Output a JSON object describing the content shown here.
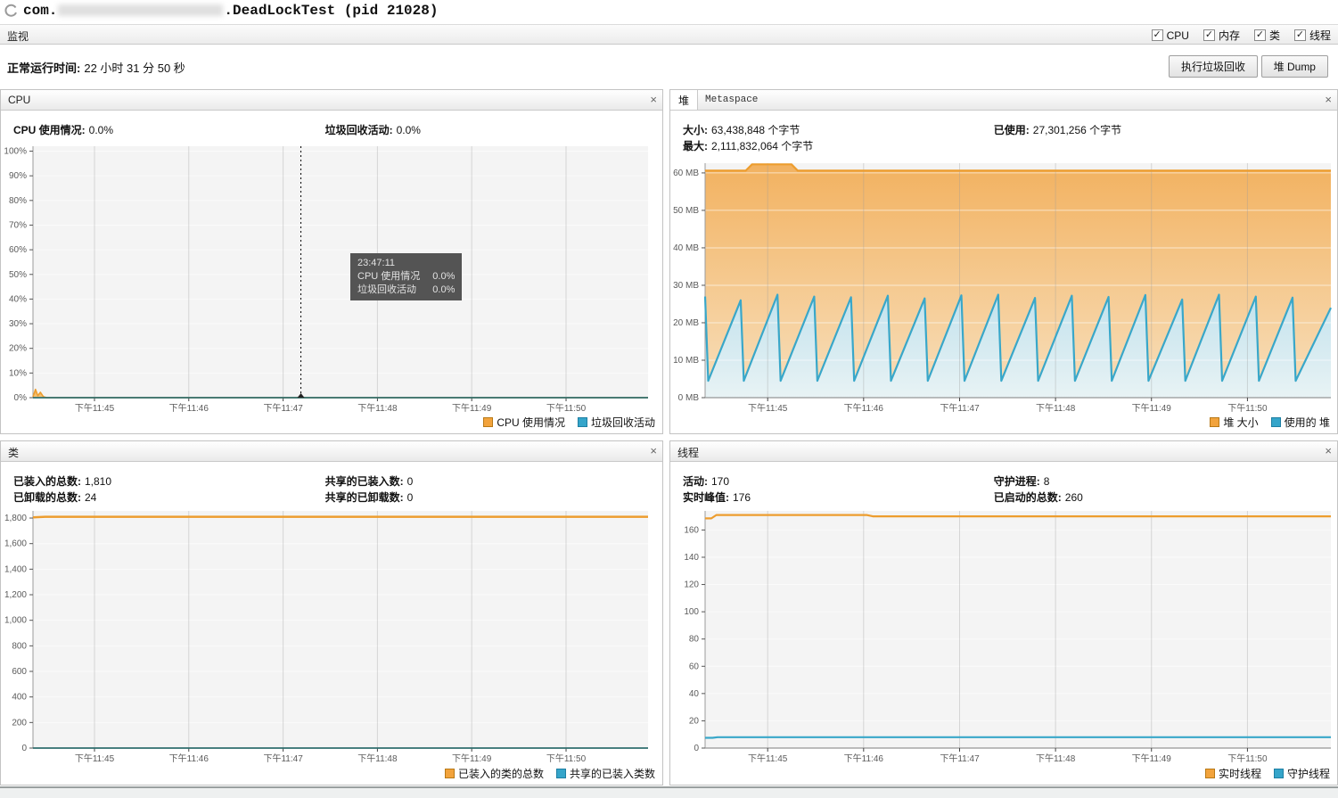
{
  "window": {
    "title": {
      "prefix": "com.",
      "suffix": ".DeadLockTest (pid 21028)"
    },
    "tabbar": {
      "tab": "监视",
      "checkboxes": [
        {
          "label": "CPU",
          "checked": true
        },
        {
          "label": "内存",
          "checked": true
        },
        {
          "label": "类",
          "checked": true
        },
        {
          "label": "线程",
          "checked": true
        }
      ],
      "check_glyph": "✓"
    },
    "toolbar": {
      "uptime_label": "正常运行时间:",
      "uptime_value": "22 小时 31 分 50 秒",
      "gc_button": "执行垃圾回收",
      "heap_dump_button": "堆 Dump"
    }
  },
  "panels": {
    "cpu": {
      "title": "CPU",
      "close": "×",
      "stats": [
        {
          "label": "CPU 使用情况:",
          "value": "0.0%"
        },
        {
          "label": "垃圾回收活动:",
          "value": "0.0%"
        }
      ]
    },
    "heap": {
      "tabs": [
        "堆",
        "Metaspace"
      ],
      "close": "×",
      "stats": [
        {
          "label": "大小:",
          "value": "63,438,848 个字节"
        },
        {
          "label": "已使用:",
          "value": "27,301,256 个字节"
        },
        {
          "label": "最大:",
          "value": "2,111,832,064 个字节"
        }
      ]
    },
    "classes": {
      "title": "类",
      "close": "×",
      "stats": [
        {
          "label": "已装入的总数:",
          "value": "1,810"
        },
        {
          "label": "共享的已装入数:",
          "value": "0"
        },
        {
          "label": "已卸载的总数:",
          "value": "24"
        },
        {
          "label": "共享的已卸载数:",
          "value": "0"
        }
      ]
    },
    "threads": {
      "title": "线程",
      "close": "×",
      "stats": [
        {
          "label": "活动:",
          "value": "170"
        },
        {
          "label": "守护进程:",
          "value": "8"
        },
        {
          "label": "实时峰值:",
          "value": "176"
        },
        {
          "label": "已启动的总数:",
          "value": "260"
        }
      ]
    }
  },
  "chart_data": [
    {
      "id": "cpu",
      "type": "area",
      "title": "CPU",
      "ylim": [
        0,
        102
      ],
      "yticks": [
        {
          "v": 0,
          "label": "0%"
        },
        {
          "v": 10,
          "label": "10%"
        },
        {
          "v": 20,
          "label": "20%"
        },
        {
          "v": 30,
          "label": "30%"
        },
        {
          "v": 40,
          "label": "40%"
        },
        {
          "v": 50,
          "label": "50%"
        },
        {
          "v": 60,
          "label": "60%"
        },
        {
          "v": 70,
          "label": "70%"
        },
        {
          "v": 80,
          "label": "80%"
        },
        {
          "v": 90,
          "label": "90%"
        },
        {
          "v": 100,
          "label": "100%"
        }
      ],
      "xticks": [
        {
          "f": 0.1,
          "label": "下午11:45"
        },
        {
          "f": 0.2533,
          "label": "下午11:46"
        },
        {
          "f": 0.4067,
          "label": "下午11:47"
        },
        {
          "f": 0.56,
          "label": "下午11:48"
        },
        {
          "f": 0.7133,
          "label": "下午11:49"
        },
        {
          "f": 0.8667,
          "label": "下午11:50"
        }
      ],
      "series": [
        {
          "name": "CPU 使用情况",
          "color": "#ed9d2e",
          "width": 1.5,
          "fill": {
            "from": "#f0a030",
            "to": "#f5c478"
          },
          "points": [
            [
              0,
              0.3
            ],
            [
              0.004,
              3.4
            ],
            [
              0.008,
              0.8
            ],
            [
              0.012,
              2.2
            ],
            [
              0.017,
              0.4
            ],
            [
              0.022,
              0
            ],
            [
              1,
              0
            ]
          ]
        },
        {
          "name": "垃圾回收活动",
          "color": "#2f6e6e",
          "width": 1.8,
          "points": [
            [
              0,
              0
            ],
            [
              1,
              0
            ]
          ]
        }
      ],
      "legend": [
        {
          "color": "#f2a33c",
          "border": "#b87916",
          "label": "CPU 使用情况"
        },
        {
          "color": "#35a5ca",
          "border": "#1e7fa3",
          "label": "垃圾回收活动"
        }
      ],
      "crosshair_f": 0.4356,
      "tooltip": {
        "time": "23:47:11",
        "rows": [
          {
            "label": "CPU 使用情况",
            "value": "0.0%"
          },
          {
            "label": "垃圾回收活动",
            "value": "0.0%"
          }
        ]
      }
    },
    {
      "id": "heap",
      "type": "area",
      "title": "堆",
      "ylim": [
        0,
        62.6
      ],
      "yticks": [
        {
          "v": 0,
          "label": "0 MB"
        },
        {
          "v": 10,
          "label": "10 MB"
        },
        {
          "v": 20,
          "label": "20 MB"
        },
        {
          "v": 30,
          "label": "30 MB"
        },
        {
          "v": 40,
          "label": "40 MB"
        },
        {
          "v": 50,
          "label": "50 MB"
        },
        {
          "v": 60,
          "label": "60 MB"
        }
      ],
      "xticks": [
        {
          "f": 0.1,
          "label": "下午11:45"
        },
        {
          "f": 0.2533,
          "label": "下午11:46"
        },
        {
          "f": 0.4067,
          "label": "下午11:47"
        },
        {
          "f": 0.56,
          "label": "下午11:48"
        },
        {
          "f": 0.7133,
          "label": "下午11:49"
        },
        {
          "f": 0.8667,
          "label": "下午11:50"
        }
      ],
      "series": [
        {
          "name": "堆 大小",
          "color": "#ed9d2e",
          "width": 2.2,
          "fill": {
            "from": "#f2ae58",
            "to": "#f8ddb6"
          },
          "points": [
            [
              0,
              60.6
            ],
            [
              0.065,
              60.6
            ],
            [
              0.075,
              62.3
            ],
            [
              0.138,
              62.3
            ],
            [
              0.148,
              60.6
            ],
            [
              1,
              60.6
            ]
          ]
        },
        {
          "name": "使用的 堆",
          "color": "#39a7c9",
          "width": 2.2,
          "fill": {
            "from": "#bfe3f2",
            "to": "#e6f5fb"
          },
          "points": [
            [
              0,
              27
            ],
            [
              0.005,
              4.5
            ],
            [
              0.0568,
              26
            ],
            [
              0.0618,
              4.5
            ],
            [
              0.1156,
              27.5
            ],
            [
              0.1206,
              4.5
            ],
            [
              0.1744,
              27
            ],
            [
              0.1794,
              4.5
            ],
            [
              0.2332,
              26.8
            ],
            [
              0.2382,
              4.5
            ],
            [
              0.292,
              27.2
            ],
            [
              0.297,
              4.5
            ],
            [
              0.3508,
              26.5
            ],
            [
              0.3558,
              4.5
            ],
            [
              0.4096,
              27.3
            ],
            [
              0.4146,
              4.5
            ],
            [
              0.4684,
              27.5
            ],
            [
              0.4734,
              4.5
            ],
            [
              0.5272,
              26.6
            ],
            [
              0.5322,
              4.5
            ],
            [
              0.586,
              27.2
            ],
            [
              0.591,
              4.5
            ],
            [
              0.6448,
              26.9
            ],
            [
              0.6498,
              4.5
            ],
            [
              0.7036,
              27.4
            ],
            [
              0.7086,
              4.5
            ],
            [
              0.7624,
              26.2
            ],
            [
              0.7674,
              4.5
            ],
            [
              0.8212,
              27.5
            ],
            [
              0.8262,
              4.5
            ],
            [
              0.88,
              27
            ],
            [
              0.885,
              4.5
            ],
            [
              0.9388,
              26.7
            ],
            [
              0.9438,
              4.5
            ],
            [
              1,
              24
            ]
          ]
        }
      ],
      "legend": [
        {
          "color": "#f2a33c",
          "border": "#b87916",
          "label": "堆 大小"
        },
        {
          "color": "#35a5ca",
          "border": "#1e7fa3",
          "label": "使用的 堆"
        }
      ]
    },
    {
      "id": "classes",
      "type": "line",
      "title": "类",
      "ylim": [
        0,
        1856
      ],
      "yticks": [
        {
          "v": 0,
          "label": "0"
        },
        {
          "v": 200,
          "label": "200"
        },
        {
          "v": 400,
          "label": "400"
        },
        {
          "v": 600,
          "label": "600"
        },
        {
          "v": 800,
          "label": "800"
        },
        {
          "v": 1000,
          "label": "1,000"
        },
        {
          "v": 1200,
          "label": "1,200"
        },
        {
          "v": 1400,
          "label": "1,400"
        },
        {
          "v": 1600,
          "label": "1,600"
        },
        {
          "v": 1800,
          "label": "1,800"
        }
      ],
      "xticks": [
        {
          "f": 0.1,
          "label": "下午11:45"
        },
        {
          "f": 0.2533,
          "label": "下午11:46"
        },
        {
          "f": 0.4067,
          "label": "下午11:47"
        },
        {
          "f": 0.56,
          "label": "下午11:48"
        },
        {
          "f": 0.7133,
          "label": "下午11:49"
        },
        {
          "f": 0.8667,
          "label": "下午11:50"
        }
      ],
      "series": [
        {
          "name": "已装入的类的总数",
          "color": "#ed9d2e",
          "width": 2.5,
          "points": [
            [
              0,
              1806
            ],
            [
              0.02,
              1810
            ],
            [
              1,
              1810
            ]
          ]
        },
        {
          "name": "共享的已装入类数",
          "color": "#2f6e6e",
          "width": 1.8,
          "points": [
            [
              0,
              0
            ],
            [
              1,
              0
            ]
          ]
        }
      ],
      "legend": [
        {
          "color": "#f2a33c",
          "border": "#b87916",
          "label": "已装入的类的总数"
        },
        {
          "color": "#35a5ca",
          "border": "#1e7fa3",
          "label": "共享的已装入类数"
        }
      ]
    },
    {
      "id": "threads",
      "type": "line",
      "title": "线程",
      "ylim": [
        0,
        174
      ],
      "yticks": [
        {
          "v": 0,
          "label": "0"
        },
        {
          "v": 20,
          "label": "20"
        },
        {
          "v": 40,
          "label": "40"
        },
        {
          "v": 60,
          "label": "60"
        },
        {
          "v": 80,
          "label": "80"
        },
        {
          "v": 100,
          "label": "100"
        },
        {
          "v": 120,
          "label": "120"
        },
        {
          "v": 140,
          "label": "140"
        },
        {
          "v": 160,
          "label": "160"
        }
      ],
      "xticks": [
        {
          "f": 0.1,
          "label": "下午11:45"
        },
        {
          "f": 0.2533,
          "label": "下午11:46"
        },
        {
          "f": 0.4067,
          "label": "下午11:47"
        },
        {
          "f": 0.56,
          "label": "下午11:48"
        },
        {
          "f": 0.7133,
          "label": "下午11:49"
        },
        {
          "f": 0.8667,
          "label": "下午11:50"
        }
      ],
      "series": [
        {
          "name": "实时线程",
          "color": "#ed9d2e",
          "width": 2.2,
          "points": [
            [
              0,
              168.5
            ],
            [
              0.01,
              168.5
            ],
            [
              0.018,
              171
            ],
            [
              0.258,
              171
            ],
            [
              0.268,
              170
            ],
            [
              1,
              170
            ]
          ]
        },
        {
          "name": "守护线程",
          "color": "#39a7c9",
          "width": 2.2,
          "points": [
            [
              0,
              7.5
            ],
            [
              0.012,
              7.5
            ],
            [
              0.02,
              8
            ],
            [
              1,
              8
            ]
          ]
        }
      ],
      "legend": [
        {
          "color": "#f2a33c",
          "border": "#b87916",
          "label": "实时线程"
        },
        {
          "color": "#35a5ca",
          "border": "#1e7fa3",
          "label": "守护线程"
        }
      ]
    }
  ]
}
